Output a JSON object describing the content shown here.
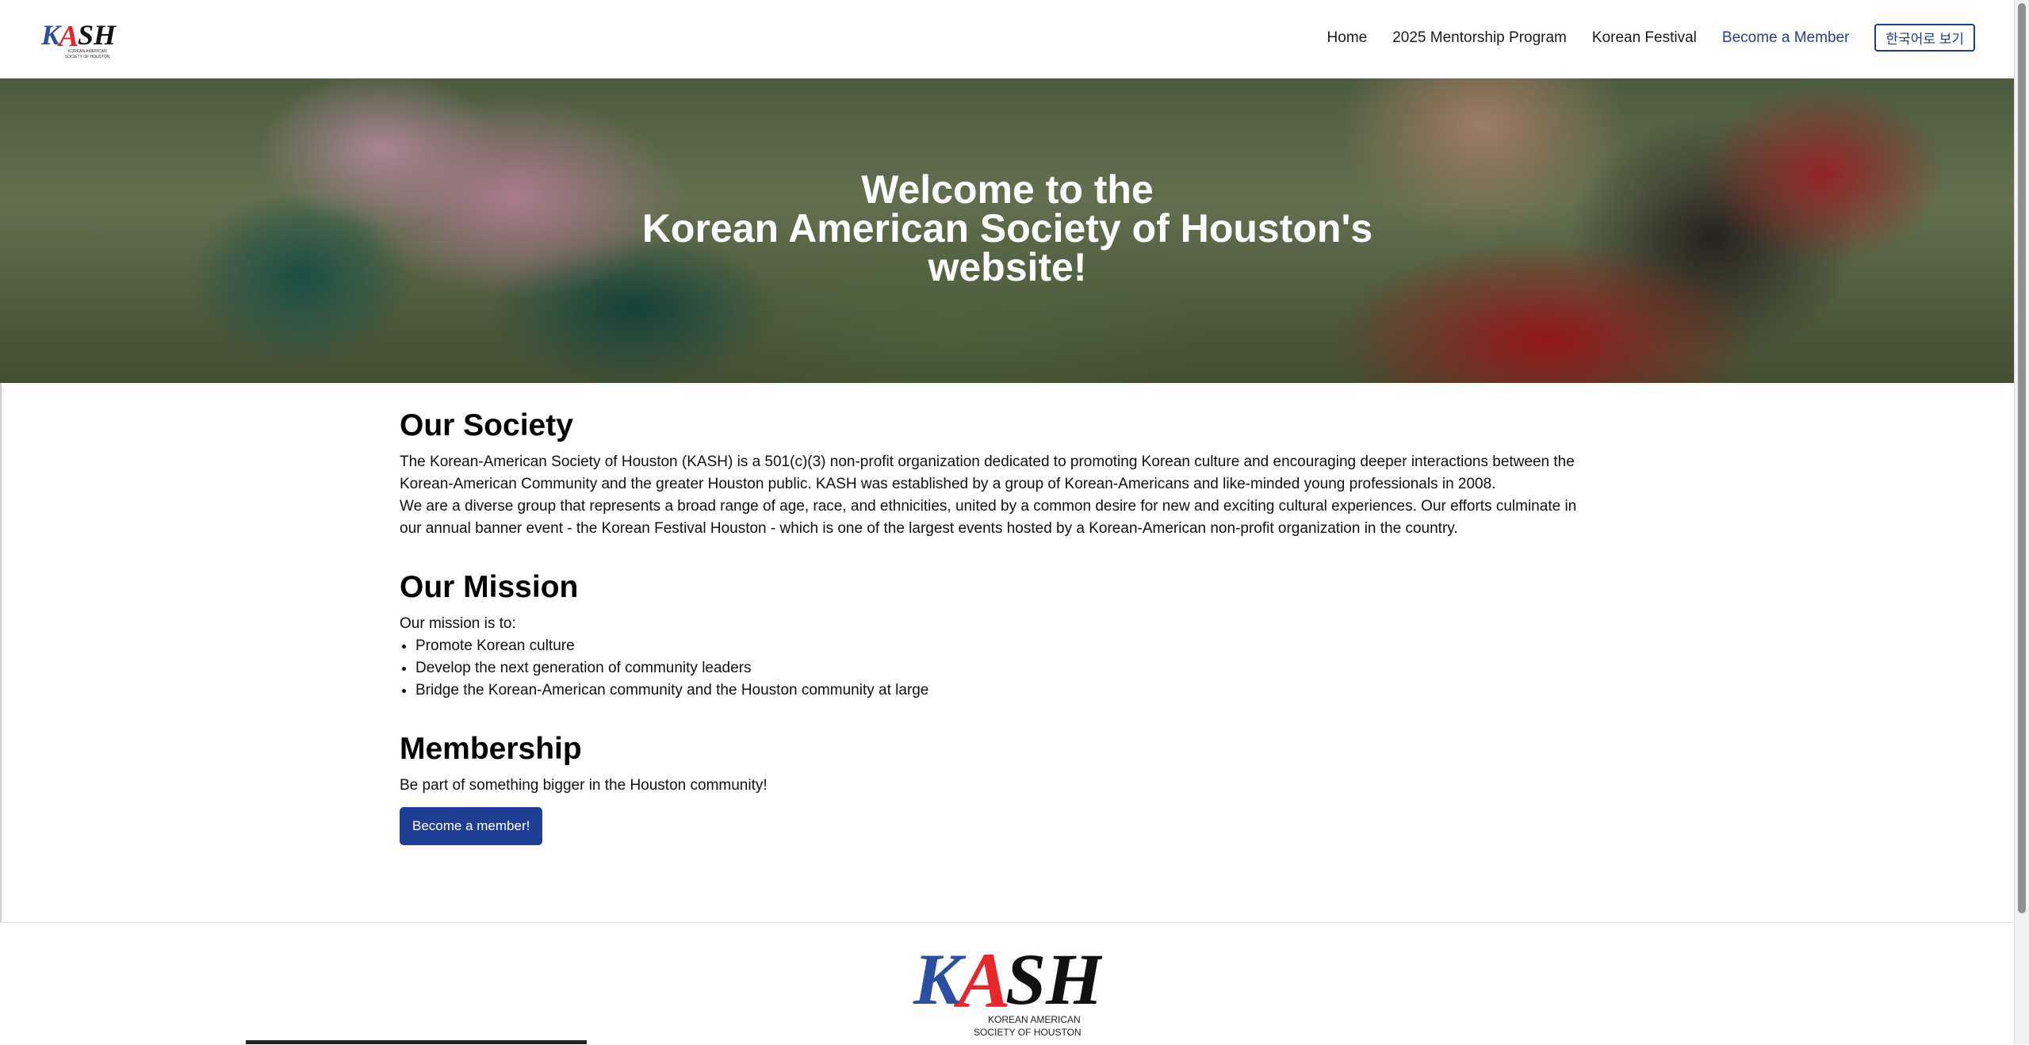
{
  "header": {
    "logo_alt": "KASH",
    "logo_subtext": "KOREAN AMERICAN SOCIETY OF HOUSTON",
    "nav": [
      {
        "label": "Home"
      },
      {
        "label": "2025 Mentorship Program"
      },
      {
        "label": "Korean Festival"
      },
      {
        "label": "Become a Member"
      },
      {
        "label": "한국어로 보기"
      }
    ]
  },
  "hero": {
    "line1": "Welcome to the",
    "line2": "Korean American Society of Houston's",
    "line3": "website!"
  },
  "society": {
    "heading": "Our Society",
    "para1": "The Korean-American Society of Houston (KASH) is a 501(c)(3) non-profit organization dedicated to promoting Korean culture and encouraging deeper interactions between the Korean-American Community and the greater Houston public. KASH was established by a group of Korean-Americans and like-minded young professionals in 2008.",
    "para2": "We are a diverse group that represents a broad range of age, race, and ethnicities, united by a common desire for new and exciting cultural experiences. Our efforts culminate in our annual banner event - the Korean Festival Houston - which is one of the largest events hosted by a Korean-American non-profit organization in the country."
  },
  "mission": {
    "heading": "Our Mission",
    "intro": "Our mission is to:",
    "items": [
      "Promote Korean culture",
      "Develop the next generation of community leaders",
      "Bridge the Korean-American community and the Houston community at large"
    ]
  },
  "membership": {
    "heading": "Membership",
    "text": "Be part of something bigger in the Houston community!",
    "button": "Become a member!"
  },
  "footer": {
    "logo_text": "KASH",
    "logo_line1": "KOREAN AMERICAN",
    "logo_line2": "SOCIETY OF HOUSTON"
  },
  "colors": {
    "accent": "#1f3f97",
    "nav_active": "#2b3f8c",
    "logo_red": "#e8262c",
    "logo_blue": "#2a4fa3"
  }
}
